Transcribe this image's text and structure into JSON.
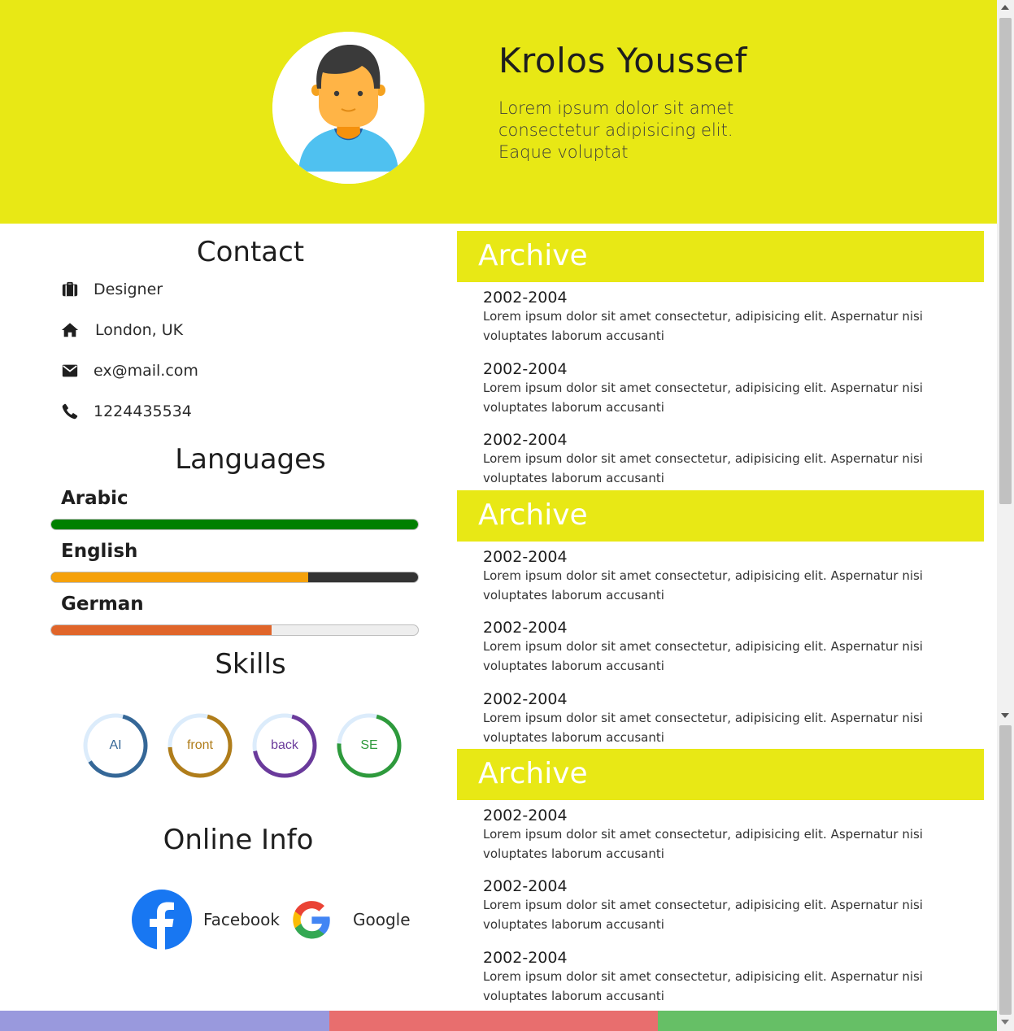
{
  "header": {
    "name": "Krolos Youssef",
    "tagline": "Lorem ipsum dolor sit amet consectetur adipisicing elit. Eaque voluptat"
  },
  "contact": {
    "title": "Contact",
    "items": [
      {
        "icon": "briefcase-icon",
        "text": "Designer"
      },
      {
        "icon": "home-icon",
        "text": "London, UK"
      },
      {
        "icon": "envelope-icon",
        "text": "ex@mail.com"
      },
      {
        "icon": "phone-icon",
        "text": "1224435534"
      }
    ]
  },
  "languages": {
    "title": "Languages",
    "items": [
      {
        "label": "Arabic",
        "level": 1.0,
        "color": "#008000",
        "track": "#ffffff"
      },
      {
        "label": "English",
        "level": 0.7,
        "color": "#f5a10b",
        "track": "#333333"
      },
      {
        "label": "German",
        "level": 0.6,
        "color": "#e0652a",
        "track": "#eeeeee"
      }
    ]
  },
  "skills": {
    "title": "Skills",
    "items": [
      {
        "label": "AI",
        "level": 0.62,
        "color": "#356797",
        "text_color": "#356797"
      },
      {
        "label": "front",
        "level": 0.7,
        "color": "#b07d1a",
        "text_color": "#b07d1a"
      },
      {
        "label": "back",
        "level": 0.68,
        "color": "#6a3a9b",
        "text_color": "#6a3a9b"
      },
      {
        "label": "SE",
        "level": 0.72,
        "color": "#2e9a3c",
        "text_color": "#2e9a3c"
      }
    ],
    "track_color": "#dcecfb"
  },
  "online": {
    "title": "Online Info",
    "items": [
      {
        "icon": "facebook-icon",
        "label": "Facebook"
      },
      {
        "icon": "google-icon",
        "label": "Google"
      }
    ]
  },
  "archives": [
    {
      "title": "Archive",
      "entries": [
        {
          "date": "2002-2004",
          "text": "Lorem ipsum dolor sit amet consectetur, adipisicing elit. Aspernatur nisi voluptates laborum accusanti"
        },
        {
          "date": "2002-2004",
          "text": "Lorem ipsum dolor sit amet consectetur, adipisicing elit. Aspernatur nisi voluptates laborum accusanti"
        },
        {
          "date": "2002-2004",
          "text": "Lorem ipsum dolor sit amet consectetur, adipisicing elit. Aspernatur nisi voluptates laborum accusanti"
        }
      ]
    },
    {
      "title": "Archive",
      "entries": [
        {
          "date": "2002-2004",
          "text": "Lorem ipsum dolor sit amet consectetur, adipisicing elit. Aspernatur nisi voluptates laborum accusanti"
        },
        {
          "date": "2002-2004",
          "text": "Lorem ipsum dolor sit amet consectetur, adipisicing elit. Aspernatur nisi voluptates laborum accusanti"
        },
        {
          "date": "2002-2004",
          "text": "Lorem ipsum dolor sit amet consectetur, adipisicing elit. Aspernatur nisi voluptates laborum accusanti"
        }
      ]
    },
    {
      "title": "Archive",
      "entries": [
        {
          "date": "2002-2004",
          "text": "Lorem ipsum dolor sit amet consectetur, adipisicing elit. Aspernatur nisi voluptates laborum accusanti"
        },
        {
          "date": "2002-2004",
          "text": "Lorem ipsum dolor sit amet consectetur, adipisicing elit. Aspernatur nisi voluptates laborum accusanti"
        },
        {
          "date": "2002-2004",
          "text": "Lorem ipsum dolor sit amet consectetur, adipisicing elit. Aspernatur nisi voluptates laborum accusanti"
        }
      ]
    }
  ],
  "colors": {
    "accent": "#e8e815",
    "stripe": [
      "#9999dd",
      "#e86e6e",
      "#66bf66"
    ]
  }
}
